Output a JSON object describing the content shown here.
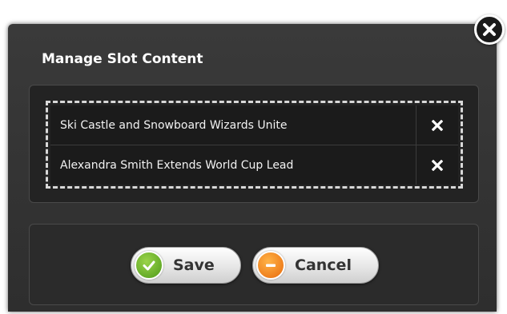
{
  "dialog": {
    "title": "Manage Slot Content",
    "close_icon": "close-icon"
  },
  "slots": [
    {
      "label": "Ski Castle and Snowboard Wizards Unite",
      "remove_icon": "remove-icon"
    },
    {
      "label": "Alexandra Smith Extends World Cup Lead",
      "remove_icon": "remove-icon"
    }
  ],
  "actions": {
    "save_label": "Save",
    "save_icon": "checkmark-icon",
    "cancel_label": "Cancel",
    "cancel_icon": "minus-icon"
  },
  "colors": {
    "dialog_bg": "#333333",
    "save_accent": "#6cbf2a",
    "cancel_accent": "#f08a1c"
  }
}
